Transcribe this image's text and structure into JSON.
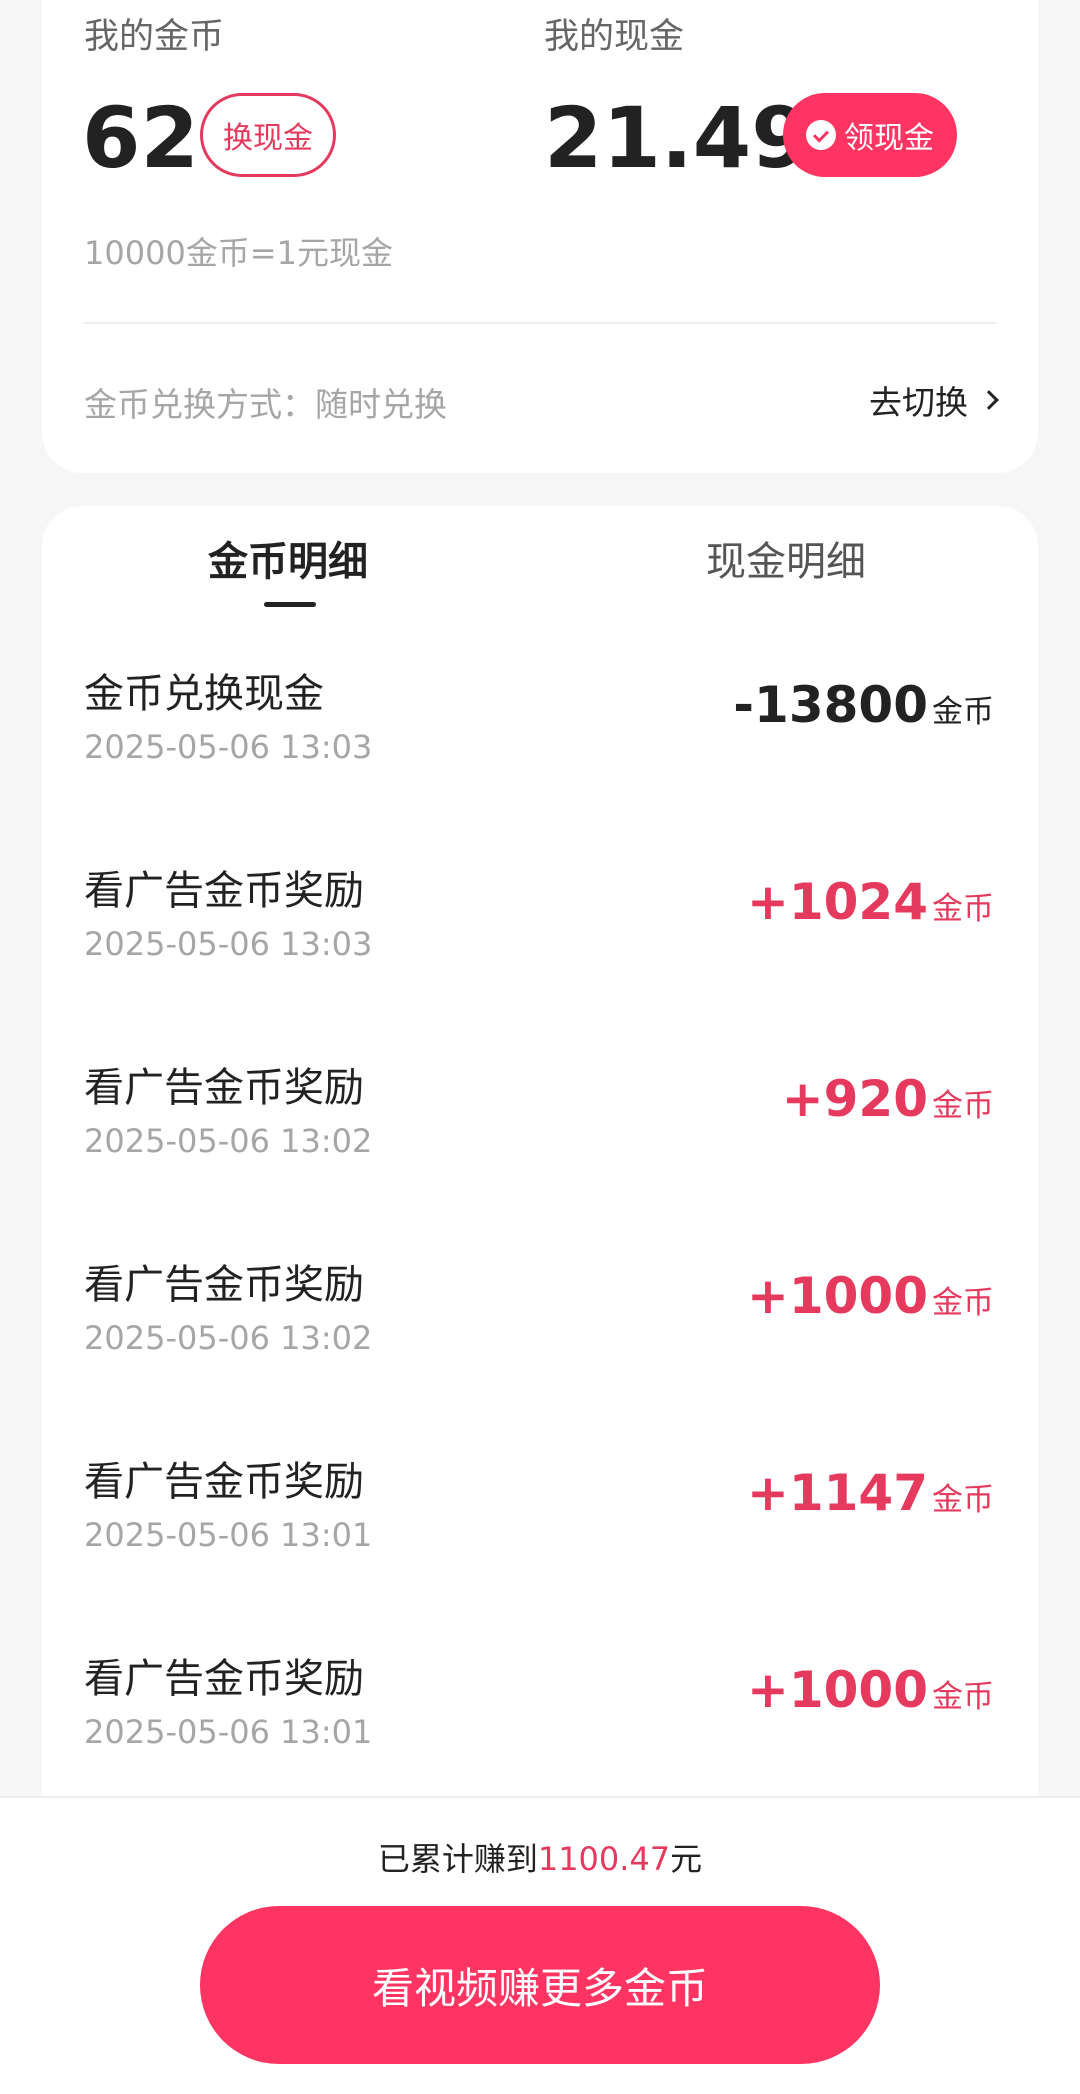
{
  "coins": {
    "label": "我的金币",
    "value": "62",
    "exchange_button": "换现金",
    "rate_text": "10000金币=1元现金",
    "method_label": "金币兑换方式：随时兑换",
    "switch_label": "去切换"
  },
  "cash": {
    "label": "我的现金",
    "value": "21.49",
    "claim_button": "领现金"
  },
  "tabs": [
    {
      "label": "金币明细",
      "active": true
    },
    {
      "label": "现金明细",
      "active": false
    }
  ],
  "transactions": [
    {
      "title": "金币兑换现金",
      "time": "2025-05-06 13:03",
      "amount": "-13800",
      "unit": "金币"
    },
    {
      "title": "看广告金币奖励",
      "time": "2025-05-06 13:03",
      "amount": "+1024",
      "unit": "金币"
    },
    {
      "title": "看广告金币奖励",
      "time": "2025-05-06 13:02",
      "amount": "+920",
      "unit": "金币"
    },
    {
      "title": "看广告金币奖励",
      "time": "2025-05-06 13:02",
      "amount": "+1000",
      "unit": "金币"
    },
    {
      "title": "看广告金币奖励",
      "time": "2025-05-06 13:01",
      "amount": "+1147",
      "unit": "金币"
    },
    {
      "title": "看广告金币奖励",
      "time": "2025-05-06 13:01",
      "amount": "+1000",
      "unit": "金币"
    }
  ],
  "footer": {
    "earned_prefix": "已累计赚到",
    "earned_value": "1100.47",
    "earned_suffix": "元",
    "cta_label": "看视频赚更多金币"
  },
  "colors": {
    "accent": "#fe3562",
    "accent_text": "#e6395e"
  }
}
